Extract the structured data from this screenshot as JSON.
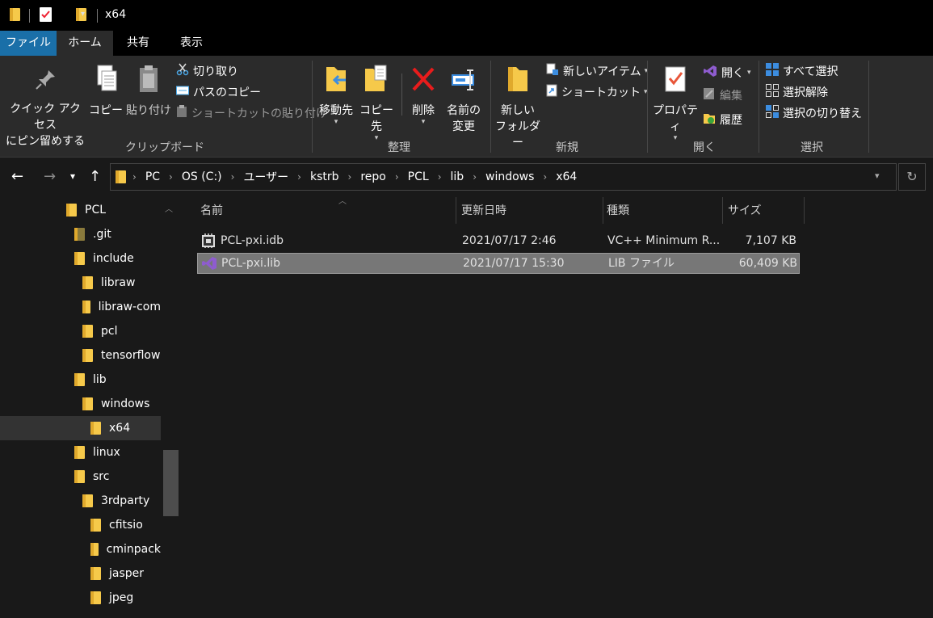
{
  "window": {
    "title": "x64"
  },
  "ribbon_tabs": [
    "ファイル",
    "ホーム",
    "共有",
    "表示"
  ],
  "ribbon": {
    "clipboard": {
      "group_label": "クリップボード",
      "pin_quick_access": [
        "クイック アクセス",
        "にピン留めする"
      ],
      "copy": "コピー",
      "paste": "貼り付け",
      "cut": "切り取り",
      "copy_path": "パスのコピー",
      "paste_shortcut": "ショートカットの貼り付け"
    },
    "organize": {
      "group_label": "整理",
      "move_to": "移動先",
      "copy_to": "コピー先",
      "delete": "削除",
      "rename": [
        "名前の",
        "変更"
      ]
    },
    "new": {
      "group_label": "新規",
      "new_folder": [
        "新しい",
        "フォルダー"
      ],
      "new_item": "新しいアイテム",
      "shortcut": "ショートカット"
    },
    "open": {
      "group_label": "開く",
      "properties": "プロパティ",
      "open": "開く",
      "edit": "編集",
      "history": "履歴"
    },
    "select": {
      "group_label": "選択",
      "select_all": "すべて選択",
      "select_none": "選択解除",
      "invert_selection": "選択の切り替え"
    }
  },
  "breadcrumb": [
    "PC",
    "OS (C:)",
    "ユーザー",
    "kstrb",
    "repo",
    "PCL",
    "lib",
    "windows",
    "x64"
  ],
  "tree": [
    {
      "label": "PCL",
      "depth": 0,
      "selected": false
    },
    {
      "label": ".git",
      "depth": 1,
      "selected": false
    },
    {
      "label": "include",
      "depth": 1,
      "selected": false
    },
    {
      "label": "libraw",
      "depth": 2,
      "selected": false
    },
    {
      "label": "libraw-com",
      "depth": 2,
      "selected": false
    },
    {
      "label": "pcl",
      "depth": 2,
      "selected": false
    },
    {
      "label": "tensorflow",
      "depth": 2,
      "selected": false
    },
    {
      "label": "lib",
      "depth": 1,
      "selected": false
    },
    {
      "label": "windows",
      "depth": 2,
      "selected": false
    },
    {
      "label": "x64",
      "depth": 3,
      "selected": true
    },
    {
      "label": "linux",
      "depth": 1,
      "selected": false
    },
    {
      "label": "src",
      "depth": 1,
      "selected": false
    },
    {
      "label": "3rdparty",
      "depth": 2,
      "selected": false
    },
    {
      "label": "cfitsio",
      "depth": 3,
      "selected": false
    },
    {
      "label": "cminpack",
      "depth": 3,
      "selected": false
    },
    {
      "label": "jasper",
      "depth": 3,
      "selected": false
    },
    {
      "label": "jpeg",
      "depth": 3,
      "selected": false
    }
  ],
  "columns": [
    "名前",
    "更新日時",
    "種類",
    "サイズ"
  ],
  "files": [
    {
      "name": "PCL-pxi.idb",
      "modified": "2021/07/17 2:46",
      "type": "VC++ Minimum R...",
      "size": "7,107 KB",
      "icon": "idb-file-icon",
      "selected": false
    },
    {
      "name": "PCL-pxi.lib",
      "modified": "2021/07/17 15:30",
      "type": "LIB ファイル",
      "size": "60,409 KB",
      "icon": "visual-studio-file-icon",
      "selected": true
    }
  ],
  "colors": {
    "file_tab": "#1a6fa8",
    "folder": "#f6c94a",
    "selected_row": "#777777",
    "background": "#191919"
  }
}
